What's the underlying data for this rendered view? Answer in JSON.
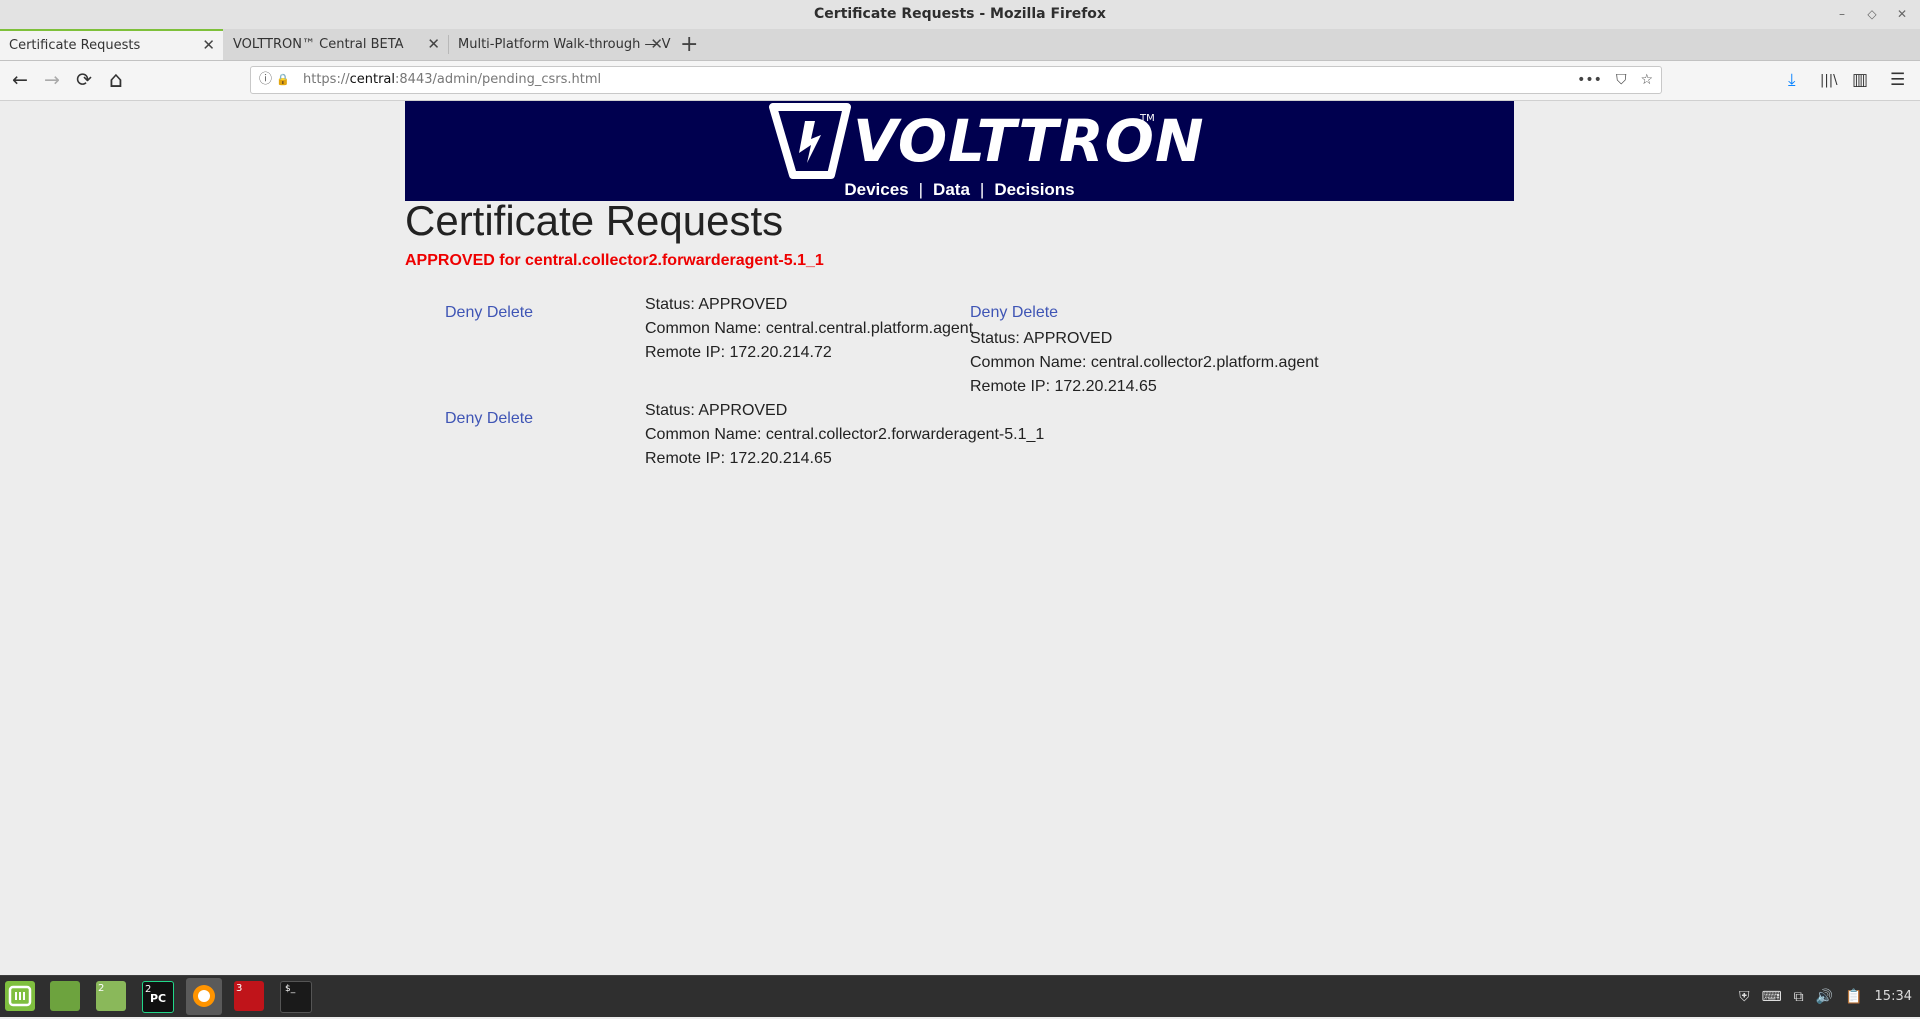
{
  "window": {
    "title": "Certificate Requests - Mozilla Firefox",
    "minimize": "–",
    "maximize": "◇",
    "close": "✕"
  },
  "tabs": [
    {
      "label": "Certificate Requests",
      "close": "✕"
    },
    {
      "label": "VOLTTRON™ Central BETA",
      "close": "✕"
    },
    {
      "label": "Multi-Platform Walk-through — V",
      "close": "✕"
    }
  ],
  "newtab_label": "+",
  "nav": {
    "back": "←",
    "forward": "→",
    "reload": "⟳",
    "home": "⌂",
    "url_scheme": "https://",
    "url_host": "central",
    "url_rest": ":8443/admin/pending_csrs.html",
    "info_icon": "ⓘ",
    "lock_icon": "🔒",
    "more": "•••",
    "pocket": "⛉",
    "star": "☆",
    "download": "⤓",
    "library": "|||\\",
    "sidebar": "▥",
    "menu": "☰"
  },
  "banner": {
    "logo_text": "VOLTTRON",
    "tm": "TM",
    "nav": [
      "Devices",
      "Data",
      "Decisions"
    ],
    "nav_sep": "|"
  },
  "page": {
    "title": "Certificate Requests",
    "message": "APPROVED for central.collector2.forwarderagent-5.1_1"
  },
  "csrs": [
    {
      "deny": "Deny",
      "delete": "Delete",
      "status": "Status: APPROVED",
      "common_name": "Common Name: central.central.platform.agent",
      "remote_ip": "Remote IP: 172.20.214.72"
    },
    {
      "deny": "Deny",
      "delete": "Delete",
      "status": "Status: APPROVED",
      "common_name": "Common Name: central.collector2.platform.agent",
      "remote_ip": "Remote IP: 172.20.214.65"
    },
    {
      "deny": "Deny",
      "delete": "Delete",
      "status": "Status: APPROVED",
      "common_name": "Common Name: central.collector2.forwarderagent-5.1_1",
      "remote_ip": "Remote IP: 172.20.214.65"
    }
  ],
  "taskbar": {
    "badges": [
      "2",
      "2",
      "3"
    ],
    "pycharm": "PC",
    "terminal": "$_",
    "clock": "15:34"
  },
  "colors": {
    "banner": "#00004f",
    "link": "#3f55b5",
    "message": "#ee0000"
  }
}
